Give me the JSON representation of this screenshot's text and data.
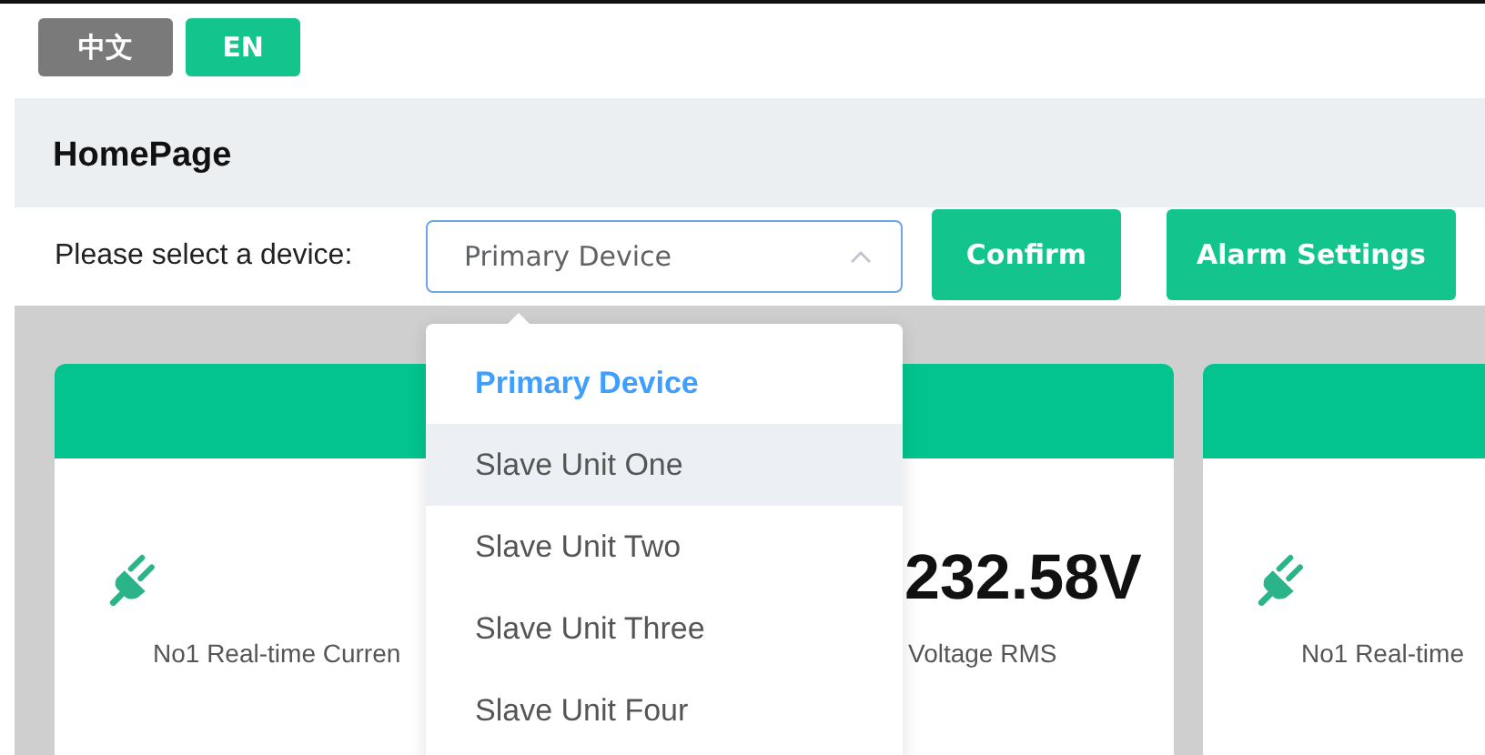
{
  "languages": [
    {
      "label": "中文",
      "selected": false
    },
    {
      "label": "EN",
      "selected": true
    }
  ],
  "page_title": "HomePage",
  "device_select": {
    "label": "Please select a device:",
    "value": "Primary Device",
    "expanded": true,
    "options": [
      {
        "label": "Primary Device",
        "selected": true,
        "hovered": false
      },
      {
        "label": "Slave Unit One",
        "selected": false,
        "hovered": true
      },
      {
        "label": "Slave Unit Two",
        "selected": false,
        "hovered": false
      },
      {
        "label": "Slave Unit Three",
        "selected": false,
        "hovered": false
      },
      {
        "label": "Slave Unit Four",
        "selected": false,
        "hovered": false
      }
    ]
  },
  "buttons": [
    "Confirm",
    "Alarm Settings"
  ],
  "cards": [
    {
      "metrics": [
        {
          "kind": "plug",
          "label": "No1 Real-time Curren"
        },
        {
          "kind": "plain",
          "value": "232.58V",
          "label": "Voltage RMS"
        }
      ]
    },
    {
      "metrics": [
        {
          "kind": "plug",
          "label": "No1 Real-time"
        }
      ]
    }
  ]
}
